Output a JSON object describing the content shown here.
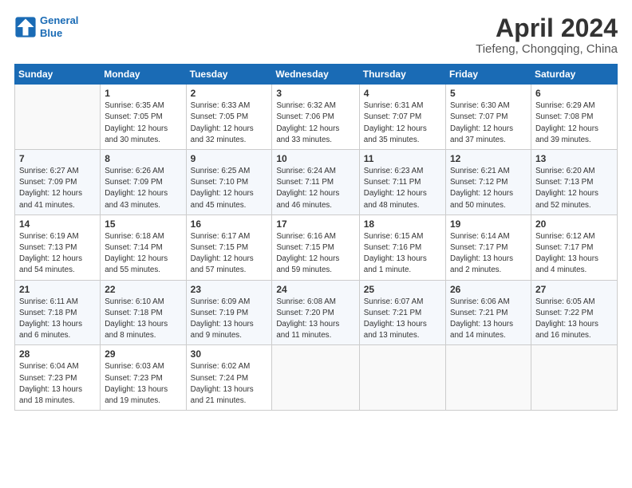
{
  "header": {
    "logo_line1": "General",
    "logo_line2": "Blue",
    "title": "April 2024",
    "subtitle": "Tiefeng, Chongqing, China"
  },
  "calendar": {
    "days_of_week": [
      "Sunday",
      "Monday",
      "Tuesday",
      "Wednesday",
      "Thursday",
      "Friday",
      "Saturday"
    ],
    "weeks": [
      [
        {
          "day": "",
          "info": ""
        },
        {
          "day": "1",
          "info": "Sunrise: 6:35 AM\nSunset: 7:05 PM\nDaylight: 12 hours\nand 30 minutes."
        },
        {
          "day": "2",
          "info": "Sunrise: 6:33 AM\nSunset: 7:05 PM\nDaylight: 12 hours\nand 32 minutes."
        },
        {
          "day": "3",
          "info": "Sunrise: 6:32 AM\nSunset: 7:06 PM\nDaylight: 12 hours\nand 33 minutes."
        },
        {
          "day": "4",
          "info": "Sunrise: 6:31 AM\nSunset: 7:07 PM\nDaylight: 12 hours\nand 35 minutes."
        },
        {
          "day": "5",
          "info": "Sunrise: 6:30 AM\nSunset: 7:07 PM\nDaylight: 12 hours\nand 37 minutes."
        },
        {
          "day": "6",
          "info": "Sunrise: 6:29 AM\nSunset: 7:08 PM\nDaylight: 12 hours\nand 39 minutes."
        }
      ],
      [
        {
          "day": "7",
          "info": "Sunrise: 6:27 AM\nSunset: 7:09 PM\nDaylight: 12 hours\nand 41 minutes."
        },
        {
          "day": "8",
          "info": "Sunrise: 6:26 AM\nSunset: 7:09 PM\nDaylight: 12 hours\nand 43 minutes."
        },
        {
          "day": "9",
          "info": "Sunrise: 6:25 AM\nSunset: 7:10 PM\nDaylight: 12 hours\nand 45 minutes."
        },
        {
          "day": "10",
          "info": "Sunrise: 6:24 AM\nSunset: 7:11 PM\nDaylight: 12 hours\nand 46 minutes."
        },
        {
          "day": "11",
          "info": "Sunrise: 6:23 AM\nSunset: 7:11 PM\nDaylight: 12 hours\nand 48 minutes."
        },
        {
          "day": "12",
          "info": "Sunrise: 6:21 AM\nSunset: 7:12 PM\nDaylight: 12 hours\nand 50 minutes."
        },
        {
          "day": "13",
          "info": "Sunrise: 6:20 AM\nSunset: 7:13 PM\nDaylight: 12 hours\nand 52 minutes."
        }
      ],
      [
        {
          "day": "14",
          "info": "Sunrise: 6:19 AM\nSunset: 7:13 PM\nDaylight: 12 hours\nand 54 minutes."
        },
        {
          "day": "15",
          "info": "Sunrise: 6:18 AM\nSunset: 7:14 PM\nDaylight: 12 hours\nand 55 minutes."
        },
        {
          "day": "16",
          "info": "Sunrise: 6:17 AM\nSunset: 7:15 PM\nDaylight: 12 hours\nand 57 minutes."
        },
        {
          "day": "17",
          "info": "Sunrise: 6:16 AM\nSunset: 7:15 PM\nDaylight: 12 hours\nand 59 minutes."
        },
        {
          "day": "18",
          "info": "Sunrise: 6:15 AM\nSunset: 7:16 PM\nDaylight: 13 hours\nand 1 minute."
        },
        {
          "day": "19",
          "info": "Sunrise: 6:14 AM\nSunset: 7:17 PM\nDaylight: 13 hours\nand 2 minutes."
        },
        {
          "day": "20",
          "info": "Sunrise: 6:12 AM\nSunset: 7:17 PM\nDaylight: 13 hours\nand 4 minutes."
        }
      ],
      [
        {
          "day": "21",
          "info": "Sunrise: 6:11 AM\nSunset: 7:18 PM\nDaylight: 13 hours\nand 6 minutes."
        },
        {
          "day": "22",
          "info": "Sunrise: 6:10 AM\nSunset: 7:18 PM\nDaylight: 13 hours\nand 8 minutes."
        },
        {
          "day": "23",
          "info": "Sunrise: 6:09 AM\nSunset: 7:19 PM\nDaylight: 13 hours\nand 9 minutes."
        },
        {
          "day": "24",
          "info": "Sunrise: 6:08 AM\nSunset: 7:20 PM\nDaylight: 13 hours\nand 11 minutes."
        },
        {
          "day": "25",
          "info": "Sunrise: 6:07 AM\nSunset: 7:21 PM\nDaylight: 13 hours\nand 13 minutes."
        },
        {
          "day": "26",
          "info": "Sunrise: 6:06 AM\nSunset: 7:21 PM\nDaylight: 13 hours\nand 14 minutes."
        },
        {
          "day": "27",
          "info": "Sunrise: 6:05 AM\nSunset: 7:22 PM\nDaylight: 13 hours\nand 16 minutes."
        }
      ],
      [
        {
          "day": "28",
          "info": "Sunrise: 6:04 AM\nSunset: 7:23 PM\nDaylight: 13 hours\nand 18 minutes."
        },
        {
          "day": "29",
          "info": "Sunrise: 6:03 AM\nSunset: 7:23 PM\nDaylight: 13 hours\nand 19 minutes."
        },
        {
          "day": "30",
          "info": "Sunrise: 6:02 AM\nSunset: 7:24 PM\nDaylight: 13 hours\nand 21 minutes."
        },
        {
          "day": "",
          "info": ""
        },
        {
          "day": "",
          "info": ""
        },
        {
          "day": "",
          "info": ""
        },
        {
          "day": "",
          "info": ""
        }
      ]
    ]
  }
}
